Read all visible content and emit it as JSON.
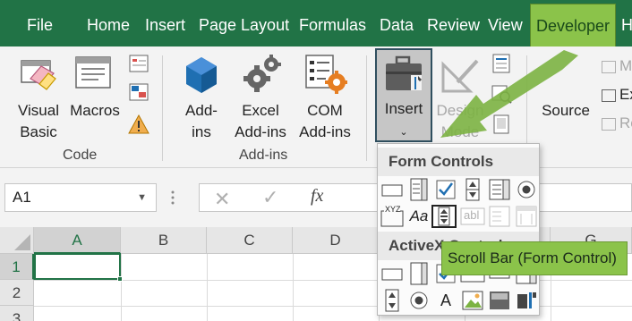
{
  "menu": {
    "tabs": [
      "File",
      "Home",
      "Insert",
      "Page Layout",
      "Formulas",
      "Data",
      "Review",
      "View",
      "Developer",
      "H"
    ],
    "active_tab": "Developer"
  },
  "ribbon": {
    "code": {
      "visual_basic": [
        "Visual",
        "Basic"
      ],
      "macros": "Macros",
      "label": "Code"
    },
    "addins": {
      "addins": [
        "Add-",
        "ins"
      ],
      "excel_addins": [
        "Excel",
        "Add-ins"
      ],
      "com_addins": [
        "COM",
        "Add-ins"
      ],
      "label": "Add-ins"
    },
    "controls": {
      "insert": "Insert",
      "design_mode": [
        "Design",
        "Mode"
      ]
    },
    "xml": {
      "source": "Source",
      "partial_items": [
        "M",
        "Ex",
        "Re"
      ]
    }
  },
  "formula_bar": {
    "name_box": "A1",
    "fx": "fx"
  },
  "grid": {
    "columns": [
      "A",
      "B",
      "C",
      "D",
      "",
      "G"
    ],
    "rows": [
      "1",
      "2",
      "3"
    ]
  },
  "insert_dropdown": {
    "form_controls_title": "Form Controls",
    "activex_title": "ActiveX Controls",
    "label_text": "Aa",
    "groupbox_text": "XYZ",
    "textfield_text": "abl",
    "activex_label_text": "A"
  },
  "tooltip": "Scroll Bar (Form Control)",
  "colors": {
    "excel_green": "#217346",
    "highlight_green": "#8bc34a",
    "accent_blue": "#1f6fb2",
    "accent_orange": "#e67e22"
  }
}
